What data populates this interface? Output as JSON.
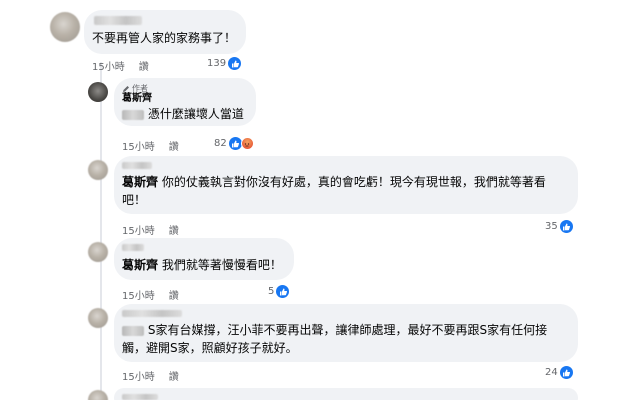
{
  "comments": [
    {
      "text": "不要再管人家的家務事了！",
      "time": "15小時",
      "action": "讚",
      "reactions": "139"
    },
    {
      "badge": "作者",
      "author": "葛斯齊",
      "text": "憑什麼讓壞人當道",
      "time": "15小時",
      "action": "讚",
      "reactions": "82"
    },
    {
      "author": "葛斯齊",
      "line1": "你的仗義執言對你沒有好處，真的會吃虧！現今有現世報，我們就等著看",
      "line2": "吧！",
      "time": "15小時",
      "action": "讚",
      "reactions": "35"
    },
    {
      "author": "葛斯齊",
      "text": "我們就等著慢慢看吧！",
      "time": "15小時",
      "action": "讚",
      "reactions": "5"
    },
    {
      "line1": "S家有台媒撐，汪小菲不要再出聲，讓律師處理，最好不要再跟S家有任何接",
      "line2": "觸，避開S家，照顧好孩子就好。",
      "time": "15小時",
      "action": "讚",
      "reactions": "24"
    }
  ],
  "colors": {
    "bubble": "#f0f2f5",
    "like": "#1877f2",
    "meta": "#65676b"
  },
  "icons": {
    "like": "thumbs-up-icon",
    "angry": "angry-face-icon",
    "author_badge": "pencil-icon"
  }
}
